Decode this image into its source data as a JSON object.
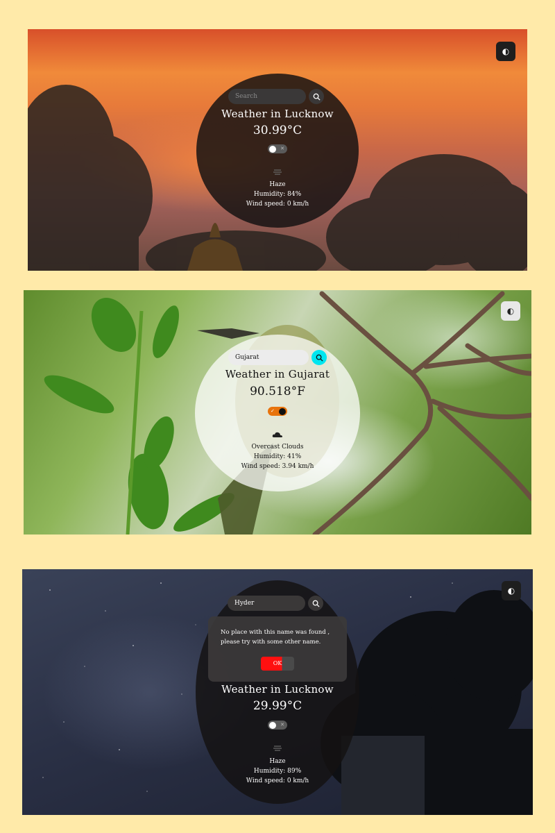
{
  "screens": [
    {
      "search": {
        "value": "",
        "placeholder": "Search"
      },
      "title": "Weather in Lucknow",
      "temperature": "30.99°C",
      "description": "Haze",
      "humidity": "Humidity: 84%",
      "wind": "Wind speed: 0 km/h",
      "theme_icon": "contrast-icon"
    },
    {
      "search": {
        "value": "Gujarat",
        "placeholder": "Search"
      },
      "title": "Weather in Gujarat",
      "temperature": "90.518°F",
      "description": "Overcast Clouds",
      "humidity": "Humidity: 41%",
      "wind": "Wind speed: 3.94 km/h",
      "theme_icon": "contrast-icon"
    },
    {
      "search": {
        "value": "Hyder",
        "placeholder": "Search"
      },
      "title": "Weather in Lucknow",
      "temperature": "29.99°C",
      "description": "Haze",
      "humidity": "Humidity: 89%",
      "wind": "Wind speed: 0 km/h",
      "theme_icon": "contrast-icon",
      "dialog": {
        "message": "No place with this name was found , please try with some other name.",
        "ok_label": "OK"
      }
    }
  ],
  "colors": {
    "page_background": "#ffeaa9",
    "search_button_active": "#00e6f0",
    "unit_switch_active": "#e8730c",
    "ok_button": "#ff1010"
  }
}
